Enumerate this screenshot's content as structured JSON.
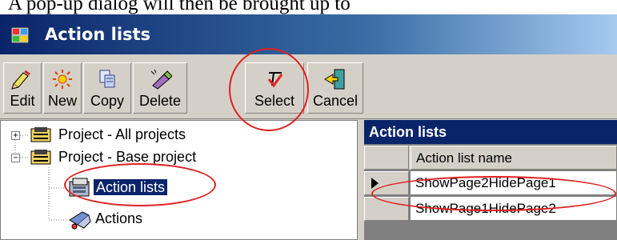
{
  "instruction": "A pop-up dialog will then be brought up to",
  "window": {
    "title": "Action lists",
    "icon": "application-window-icon"
  },
  "toolbar": {
    "buttons": [
      {
        "label": "Edit",
        "icon": "edit-icon"
      },
      {
        "label": "New",
        "icon": "new-icon"
      },
      {
        "label": "Copy",
        "icon": "copy-icon"
      },
      {
        "label": "Delete",
        "icon": "delete-icon"
      },
      {
        "label": "Select",
        "icon": "select-icon"
      },
      {
        "label": "Cancel",
        "icon": "cancel-icon"
      }
    ]
  },
  "tree": {
    "items": [
      {
        "label": "Project - All projects",
        "expander": "+",
        "icon": "project-icon"
      },
      {
        "label": "Project - Base project",
        "expander": "−",
        "icon": "project-icon"
      },
      {
        "label": "Action lists",
        "icon": "action-lists-icon",
        "selected": true
      },
      {
        "label": "Actions",
        "icon": "actions-icon"
      }
    ]
  },
  "grid": {
    "title": "Action lists",
    "column_header": "Action list name",
    "rows": [
      {
        "name": "ShowPage2HidePage1",
        "current": true
      },
      {
        "name": "ShowPage1HidePage2",
        "current": false
      }
    ]
  },
  "colors": {
    "titlebar": "#0a246a",
    "selection": "#0a246a",
    "highlight_ellipse": "#e02020",
    "window_face": "#d4d0c8"
  }
}
